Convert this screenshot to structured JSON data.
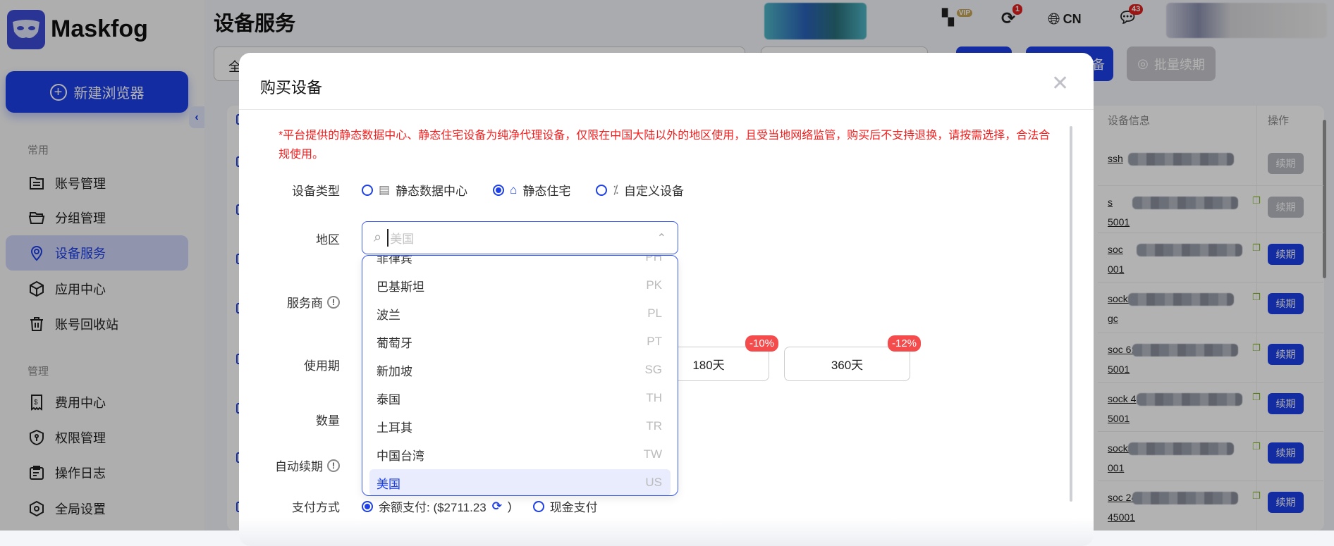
{
  "sidebar": {
    "brand": "Maskfog",
    "new_browser": "新建浏览器",
    "section_common": "常用",
    "section_manage": "管理",
    "items": [
      {
        "label": "账号管理",
        "icon": "account-list-icon"
      },
      {
        "label": "分组管理",
        "icon": "folder-icon"
      },
      {
        "label": "设备服务",
        "icon": "location-pin-icon",
        "active": true
      },
      {
        "label": "应用中心",
        "icon": "cube-icon"
      },
      {
        "label": "账号回收站",
        "icon": "trash-icon"
      },
      {
        "label": "费用中心",
        "icon": "receipt-dollar-icon"
      },
      {
        "label": "权限管理",
        "icon": "shield-key-icon"
      },
      {
        "label": "操作日志",
        "icon": "clipboard-icon"
      },
      {
        "label": "全局设置",
        "icon": "hexagon-gear-icon"
      }
    ]
  },
  "header": {
    "title": "设备服务",
    "vip": "VIP",
    "sync_badge": "1",
    "language": "CN",
    "message_badge": "43"
  },
  "toolbar": {
    "filter_all": "全",
    "buy_button_fragment": "备",
    "batch_renew": "批量续期"
  },
  "table": {
    "col_device_info": "设备信息",
    "col_action": "操作",
    "rows": [
      {
        "l1": "ssh",
        "l2": "",
        "action": "续期",
        "disabled": true
      },
      {
        "l1": "s",
        "l2": "5001",
        "action": "续期",
        "disabled": true
      },
      {
        "l1": "soc",
        "l2": "001",
        "action": "续期",
        "disabled": false
      },
      {
        "l1": "socks5://pop-my-",
        "l2": "gc",
        "action": "续期",
        "disabled": false
      },
      {
        "l1": "soc        6:4",
        "l2": "5001",
        "action": "续期",
        "disabled": false
      },
      {
        "l1": "sock        4",
        "l2": "5001",
        "action": "续期",
        "disabled": false
      },
      {
        "l1": "socks        5",
        "l2": "001",
        "action": "续期",
        "disabled": false
      },
      {
        "l1": "soc        24:",
        "l2": "45001",
        "action": "续期",
        "disabled": false
      }
    ]
  },
  "modal": {
    "title": "购买设备",
    "warning": "*平台提供的静态数据中心、静态住宅设备为纯净代理设备，仅限在中国大陆以外的地区使用，且受当地网络监管，购买后不支持退换，请按需选择，合法合规使用。",
    "labels": {
      "device_type": "设备类型",
      "region": "地区",
      "provider": "服务商",
      "period": "使用期",
      "quantity": "数量",
      "auto_renew": "自动续期",
      "payment": "支付方式"
    },
    "device_types": [
      {
        "label": "静态数据中心",
        "selected": false
      },
      {
        "label": "静态住宅",
        "selected": true
      },
      {
        "label": "自定义设备",
        "selected": false
      }
    ],
    "region_placeholder": "美国",
    "region_options": [
      {
        "name": "菲律宾",
        "code": "PH"
      },
      {
        "name": "巴基斯坦",
        "code": "PK"
      },
      {
        "name": "波兰",
        "code": "PL"
      },
      {
        "name": "葡萄牙",
        "code": "PT"
      },
      {
        "name": "新加坡",
        "code": "SG"
      },
      {
        "name": "泰国",
        "code": "TH"
      },
      {
        "name": "土耳其",
        "code": "TR"
      },
      {
        "name": "中国台湾",
        "code": "TW"
      },
      {
        "name": "美国",
        "code": "US",
        "selected": true
      }
    ],
    "periods": [
      {
        "label": "180天",
        "discount": "-10%"
      },
      {
        "label": "360天",
        "discount": "-12%"
      }
    ],
    "payment": {
      "balance_label": "余额支付: ($2711.23",
      "balance_close": ")",
      "cash_label": "现金支付",
      "selected": "balance"
    }
  },
  "colors": {
    "primary": "#1e40e8",
    "danger": "#f02020",
    "discount": "#f44c4c"
  }
}
